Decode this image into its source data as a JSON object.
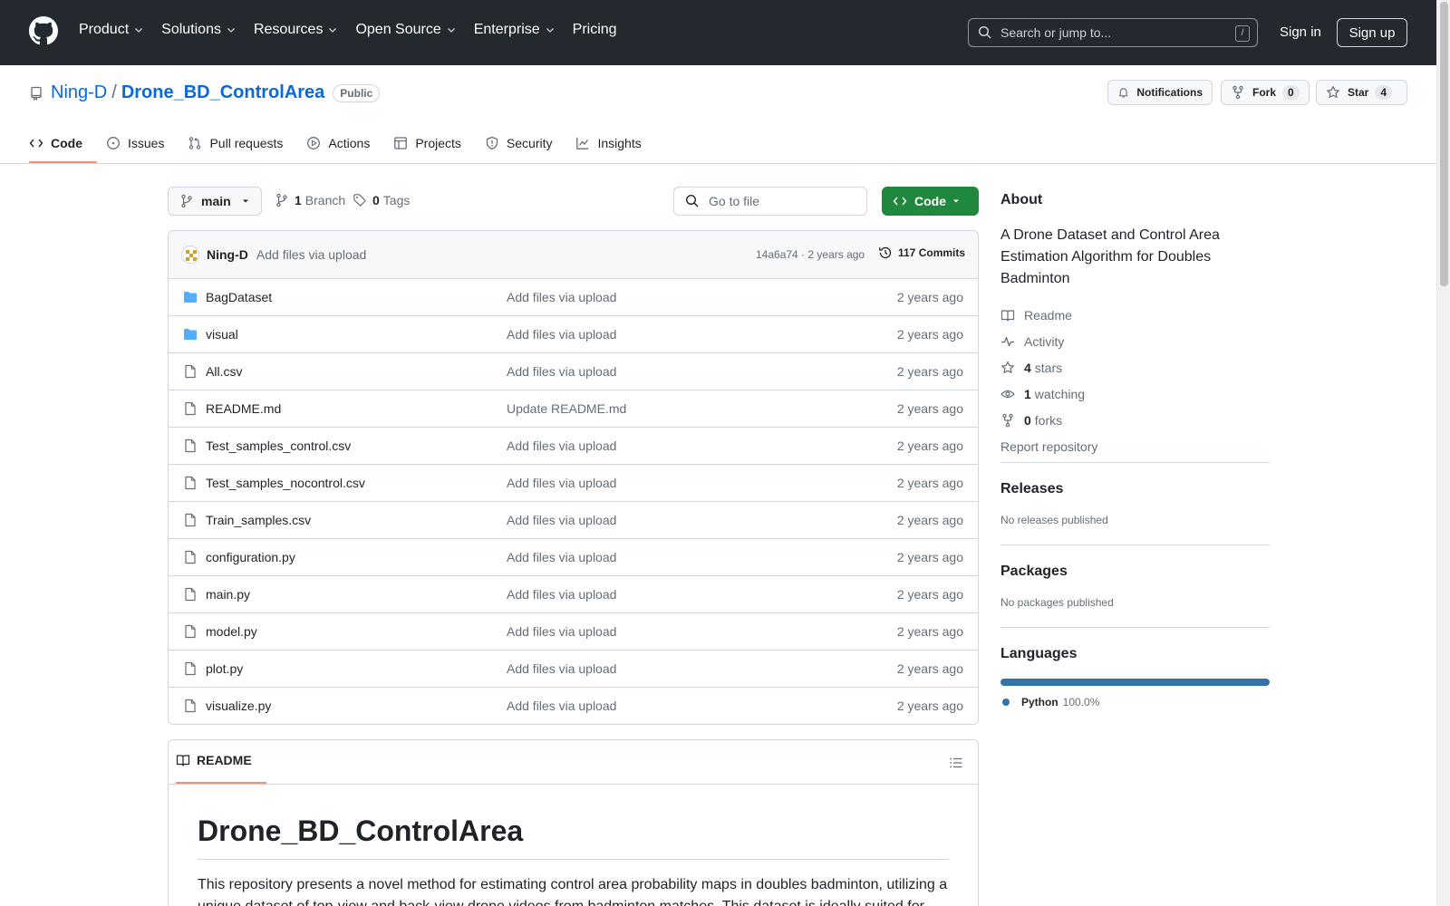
{
  "header": {
    "nav": [
      {
        "label": "Product",
        "dropdown": true
      },
      {
        "label": "Solutions",
        "dropdown": true
      },
      {
        "label": "Resources",
        "dropdown": true
      },
      {
        "label": "Open Source",
        "dropdown": true
      },
      {
        "label": "Enterprise",
        "dropdown": true
      },
      {
        "label": "Pricing",
        "dropdown": false
      }
    ],
    "search_placeholder": "Search or jump to...",
    "search_shortcut": "/",
    "signin": "Sign in",
    "signup": "Sign up"
  },
  "repo": {
    "owner": "Ning-D",
    "separator": "/",
    "name": "Drone_BD_ControlArea",
    "visibility": "Public",
    "notifications_label": "Notifications",
    "fork_label": "Fork",
    "fork_count": "0",
    "star_label": "Star",
    "star_count": "4"
  },
  "tabs": [
    {
      "label": "Code",
      "icon": "code-icon",
      "active": true
    },
    {
      "label": "Issues",
      "icon": "issue-icon",
      "active": false
    },
    {
      "label": "Pull requests",
      "icon": "pull-request-icon",
      "active": false
    },
    {
      "label": "Actions",
      "icon": "play-icon",
      "active": false
    },
    {
      "label": "Projects",
      "icon": "table-icon",
      "active": false
    },
    {
      "label": "Security",
      "icon": "shield-icon",
      "active": false
    },
    {
      "label": "Insights",
      "icon": "graph-icon",
      "active": false
    }
  ],
  "toolbar": {
    "branch": "main",
    "branch_count": "1",
    "branch_label": "Branch",
    "tag_count": "0",
    "tag_label": "Tags",
    "goto_placeholder": "Go to file",
    "code_label": "Code"
  },
  "commit": {
    "author": "Ning-D",
    "message": "Add files via upload",
    "hash_and_date": "14a6a74 · 2 years ago",
    "commits_label": "117 Commits"
  },
  "files": [
    {
      "name": "BagDataset",
      "type": "folder",
      "message": "Add files via upload",
      "date": "2 years ago"
    },
    {
      "name": "visual",
      "type": "folder",
      "message": "Add files via upload",
      "date": "2 years ago"
    },
    {
      "name": "All.csv",
      "type": "file",
      "message": "Add files via upload",
      "date": "2 years ago"
    },
    {
      "name": "README.md",
      "type": "file",
      "message": "Update README.md",
      "date": "2 years ago"
    },
    {
      "name": "Test_samples_control.csv",
      "type": "file",
      "message": "Add files via upload",
      "date": "2 years ago"
    },
    {
      "name": "Test_samples_nocontrol.csv",
      "type": "file",
      "message": "Add files via upload",
      "date": "2 years ago"
    },
    {
      "name": "Train_samples.csv",
      "type": "file",
      "message": "Add files via upload",
      "date": "2 years ago"
    },
    {
      "name": "configuration.py",
      "type": "file",
      "message": "Add files via upload",
      "date": "2 years ago"
    },
    {
      "name": "main.py",
      "type": "file",
      "message": "Add files via upload",
      "date": "2 years ago"
    },
    {
      "name": "model.py",
      "type": "file",
      "message": "Add files via upload",
      "date": "2 years ago"
    },
    {
      "name": "plot.py",
      "type": "file",
      "message": "Add files via upload",
      "date": "2 years ago"
    },
    {
      "name": "visualize.py",
      "type": "file",
      "message": "Add files via upload",
      "date": "2 years ago"
    }
  ],
  "readme": {
    "tab_label": "README",
    "title": "Drone_BD_ControlArea",
    "paragraph": "This repository presents a novel method for estimating control area probability maps in doubles badminton, utilizing a unique dataset of top-view and back-view drone videos from badminton matches. This dataset is ideally suited for"
  },
  "about": {
    "heading": "About",
    "description": "A Drone Dataset and Control Area Estimation Algorithm for Doubles Badminton",
    "readme_label": "Readme",
    "activity_label": "Activity",
    "stars_count": "4",
    "stars_label": "stars",
    "watching_count": "1",
    "watching_label": "watching",
    "forks_count": "0",
    "forks_label": "forks",
    "report_label": "Report repository"
  },
  "releases": {
    "heading": "Releases",
    "empty": "No releases published"
  },
  "packages": {
    "heading": "Packages",
    "empty": "No packages published"
  },
  "languages": {
    "heading": "Languages",
    "items": [
      {
        "name": "Python",
        "percent": "100.0%",
        "color": "#3572a5"
      }
    ]
  },
  "colors": {
    "header_bg": "#24292f",
    "link": "#0969da",
    "primary_button": "#1f883d",
    "tab_underline": "#fd8c73",
    "folder": "#54aeff"
  }
}
